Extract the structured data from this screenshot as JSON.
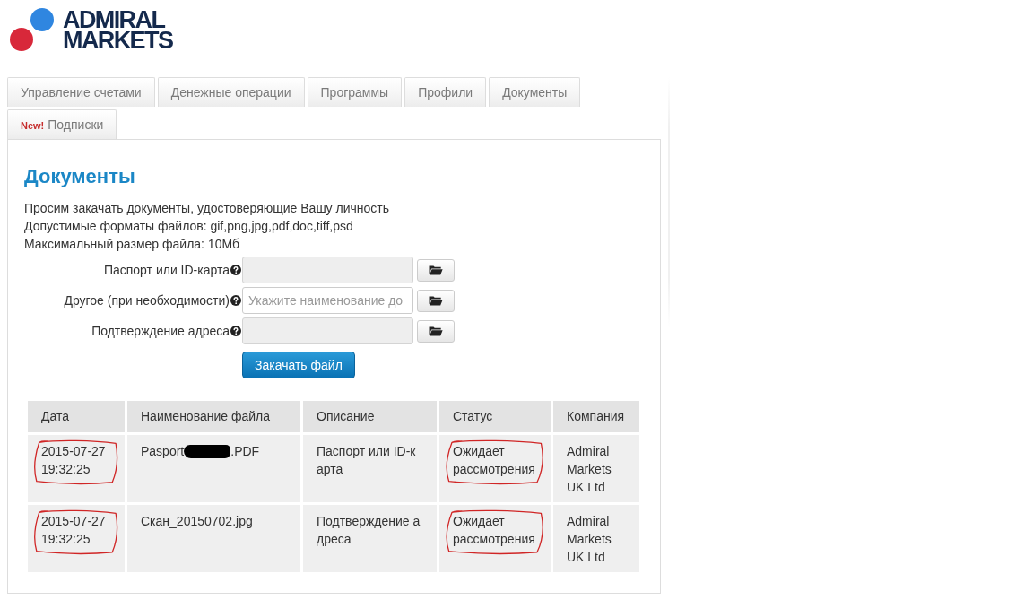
{
  "logo": {
    "lines": [
      "ADMIRAL",
      "MARKETS"
    ]
  },
  "tabs": [
    {
      "label": "Управление счетами",
      "selected": false
    },
    {
      "label": "Денежные операции",
      "selected": false
    },
    {
      "label": "Программы",
      "selected": false
    },
    {
      "label": "Профили",
      "selected": false
    },
    {
      "label": "Документы",
      "selected": false
    },
    {
      "label": "Подписки",
      "badge": "New!",
      "selected": false
    }
  ],
  "panel": {
    "title": "Документы",
    "intro": [
      "Просим закачать документы, удостоверяющие Вашу личность",
      "Допустимые форматы файлов: gif,png,jpg,pdf,doc,tiff,psd",
      "Максимальный размер файла: 10Мб"
    ],
    "fields": [
      {
        "label": "Паспорт или ID-карта",
        "disabled": true
      },
      {
        "label": "Другое (при необходимости)",
        "placeholder": "Укажите наименование до",
        "disabled": false
      },
      {
        "label": "Подтверждение адреса",
        "disabled": true
      }
    ],
    "submit": "Закачать файл"
  },
  "table": {
    "columns": [
      "Дата",
      "Наименование файла",
      "Описание",
      "Статус",
      "Компания"
    ],
    "rows": [
      {
        "date": {
          "text": "2015-07-27 19:32:25",
          "circled": true
        },
        "file": {
          "name_start": "Pasport",
          "redacted": true,
          "name_end": ".PDF"
        },
        "description": "Паспорт или ID-карта",
        "status": {
          "text": "Ожидает рассмотрения",
          "circled": true
        },
        "company": "Admiral Markets UK Ltd"
      },
      {
        "date": {
          "text": "2015-07-27 19:32:25",
          "circled": true
        },
        "file": {
          "name_start": "Скан_20150702.jpg",
          "redacted": false
        },
        "description": "Подтверждение адреса",
        "status": {
          "text": "Ожидает рассмотрения",
          "circled": true
        },
        "company": "Admiral Markets UK Ltd"
      }
    ]
  }
}
